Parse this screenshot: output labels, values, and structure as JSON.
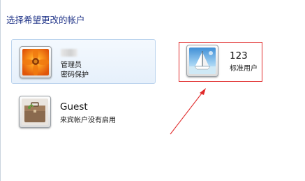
{
  "heading": "选择希望更改的帐户",
  "accounts": [
    {
      "name": "",
      "type_line1": "管理员",
      "type_line2": "密码保护",
      "avatar": "orange-flower-avatar-icon"
    },
    {
      "name": "123",
      "type_line1": "标准用户",
      "avatar": "sailboat-avatar-icon"
    },
    {
      "name": "Guest",
      "type_line1": "来宾帐户没有启用",
      "avatar": "briefcase-avatar-icon"
    }
  ],
  "annotation": {
    "box_color": "#e02b2b",
    "arrow_color": "#e02b2b"
  }
}
